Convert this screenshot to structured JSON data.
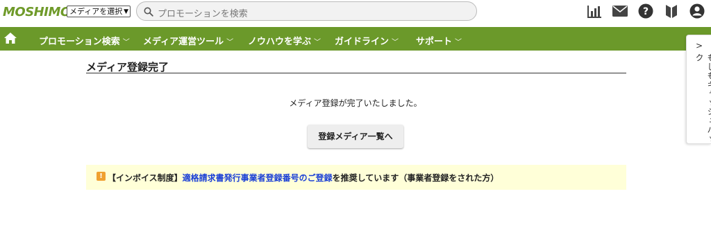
{
  "header": {
    "logo": "MOSHIMO",
    "media_select": "メディアを選択",
    "search_placeholder": "プロモーションを検索",
    "icons": [
      "report-icon",
      "mail-icon",
      "help-icon",
      "beginner-icon",
      "user-icon"
    ]
  },
  "nav": {
    "items": [
      {
        "label": "プロモーション検索"
      },
      {
        "label": "メディア運営ツール"
      },
      {
        "label": "ノウハウを学ぶ"
      },
      {
        "label": "ガイドライン"
      },
      {
        "label": "サポート"
      }
    ]
  },
  "sidetab": {
    "label": "もしもキャッシュバック"
  },
  "main": {
    "title": "メディア登録完了",
    "message": "メディア登録が完了いたしました。",
    "button": "登録メディア一覧へ"
  },
  "notice": {
    "prefix": "【インボイス制度】",
    "link": "適格請求書発行事業者登録番号のご登録",
    "suffix": "を推奨しています（事業者登録をされた方）"
  },
  "colors": {
    "nav_green": "#6b992a",
    "notice_bg": "#ffffd8",
    "link": "#1a3fd6",
    "warn": "#f0a030"
  }
}
